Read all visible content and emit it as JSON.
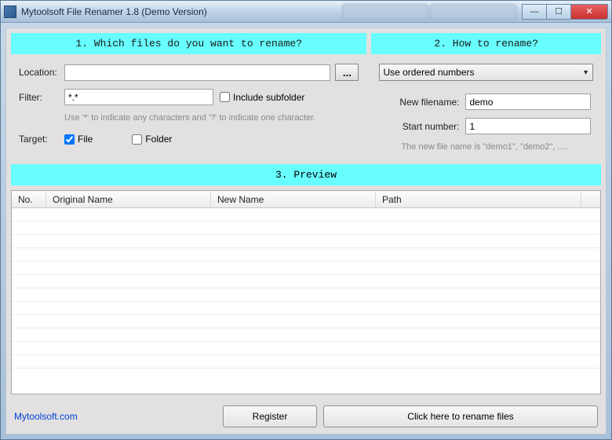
{
  "window": {
    "title": "Mytoolsoft File Renamer 1.8 (Demo Version)"
  },
  "section1": {
    "title": "1. Which files do you want to rename?",
    "location_label": "Location:",
    "location_value": "",
    "browse_label": "...",
    "filter_label": "Filter:",
    "filter_value": "*.*",
    "include_subfolder_label": "Include subfolder",
    "include_subfolder_checked": false,
    "filter_hint": "Use '*' to indicate any characters and '?' to indicate one character.",
    "target_label": "Target:",
    "target_file_label": "File",
    "target_file_checked": true,
    "target_folder_label": "Folder",
    "target_folder_checked": false
  },
  "section2": {
    "title": "2. How to rename?",
    "mode_selected": "Use ordered numbers",
    "new_filename_label": "New filename:",
    "new_filename_value": "demo",
    "start_number_label": "Start number:",
    "start_number_value": "1",
    "hint": "The new file name is \"demo1\", \"demo2\", ...."
  },
  "section3": {
    "title": "3. Preview",
    "columns": {
      "no": "No.",
      "original": "Original Name",
      "new": "New Name",
      "path": "Path"
    },
    "rows": []
  },
  "footer": {
    "link": "Mytoolsoft.com",
    "register": "Register",
    "rename": "Click here to rename files"
  }
}
